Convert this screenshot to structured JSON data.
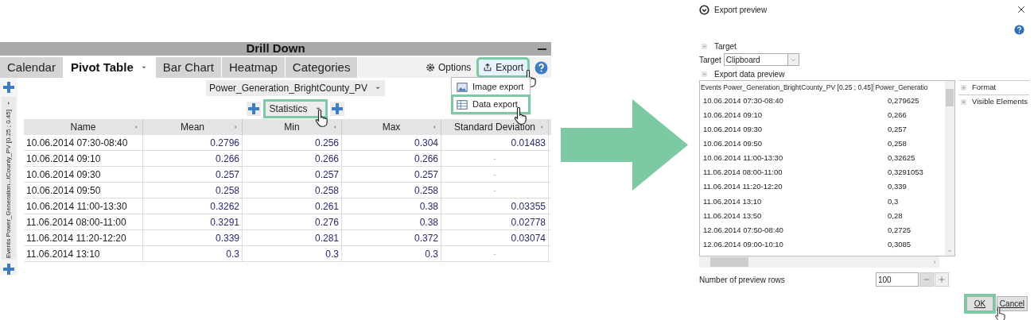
{
  "drill_down": {
    "title": "Drill Down",
    "tabs": [
      {
        "label": "Calendar",
        "selected": false,
        "dropdown": false
      },
      {
        "label": "Pivot Table",
        "selected": true,
        "dropdown": true
      },
      {
        "label": "Bar Chart",
        "selected": false,
        "dropdown": false
      },
      {
        "label": "Heatmap",
        "selected": false,
        "dropdown": false
      },
      {
        "label": "Categories",
        "selected": false,
        "dropdown": false
      }
    ],
    "options_button": "Options",
    "export_button": {
      "label": "Export",
      "highlighted": true
    },
    "export_menu": [
      {
        "label": "Image export",
        "highlighted": false
      },
      {
        "label": "Data export",
        "highlighted": true
      }
    ],
    "column_field": "Power_Generation_BrightCounty_PV",
    "statistics_field": {
      "label": "Statistics",
      "highlighted": true
    },
    "row_axis_label": "Events Power_Generation...tCounty_PV [0.25 ; 0.45]",
    "table": {
      "columns": [
        "Name",
        "Mean",
        "Min",
        "Max",
        "Standard Deviation"
      ],
      "rows": [
        [
          "10.06.2014 07:30-08:40",
          "0.2796",
          "0.256",
          "0.304",
          "0.01483"
        ],
        [
          "10.06.2014 09:10",
          "0.266",
          "0.266",
          "0.266",
          "-"
        ],
        [
          "10.06.2014 09:30",
          "0.257",
          "0.257",
          "0.257",
          "-"
        ],
        [
          "10.06.2014 09:50",
          "0.258",
          "0.258",
          "0.258",
          "-"
        ],
        [
          "10.06.2014 11:00-13:30",
          "0.3262",
          "0.261",
          "0.38",
          "0.03355"
        ],
        [
          "11.06.2014 08:00-11:00",
          "0.3291",
          "0.276",
          "0.38",
          "0.02778"
        ],
        [
          "11.06.2014 11:20-12:20",
          "0.339",
          "0.281",
          "0.372",
          "0.03074"
        ],
        [
          "11.06.2014 13:10",
          "0.3",
          "0.3",
          "0.3",
          "-"
        ]
      ]
    }
  },
  "dialog": {
    "title": "Export preview",
    "target_section": "Target",
    "target_label": "Target",
    "target_value": "Clipboard",
    "preview_section": "Export data preview",
    "preview_header": [
      "Events Power_Generation_BrightCounty_PV [0.25 ; 0.45]",
      "Power_Generatio"
    ],
    "preview_rows": [
      [
        "10.06.2014 07:30-08:40",
        "0,279625"
      ],
      [
        "10.06.2014 09:10",
        "0,266"
      ],
      [
        "10.06.2014 09:30",
        "0,257"
      ],
      [
        "10.06.2014 09:50",
        "0,258"
      ],
      [
        "10.06.2014 11:00-13:30",
        "0,32625"
      ],
      [
        "11.06.2014 08:00-11:00",
        "0,3291053"
      ],
      [
        "11.06.2014 11:20-12:20",
        "0,339"
      ],
      [
        "11.06.2014 13:10",
        "0,3"
      ],
      [
        "11.06.2014 13:50",
        "0,28"
      ],
      [
        "12.06.2014 07:50-08:40",
        "0,2725"
      ],
      [
        "12.06.2014 09:00-10:10",
        "0,3085"
      ]
    ],
    "side_sections": [
      "Format",
      "Visible Elements"
    ],
    "preview_rows_label": "Number of preview rows",
    "preview_rows_value": "100",
    "buttons": [
      {
        "label": "OK",
        "highlighted": true
      },
      {
        "label": "Cancel",
        "highlighted": false
      }
    ]
  }
}
